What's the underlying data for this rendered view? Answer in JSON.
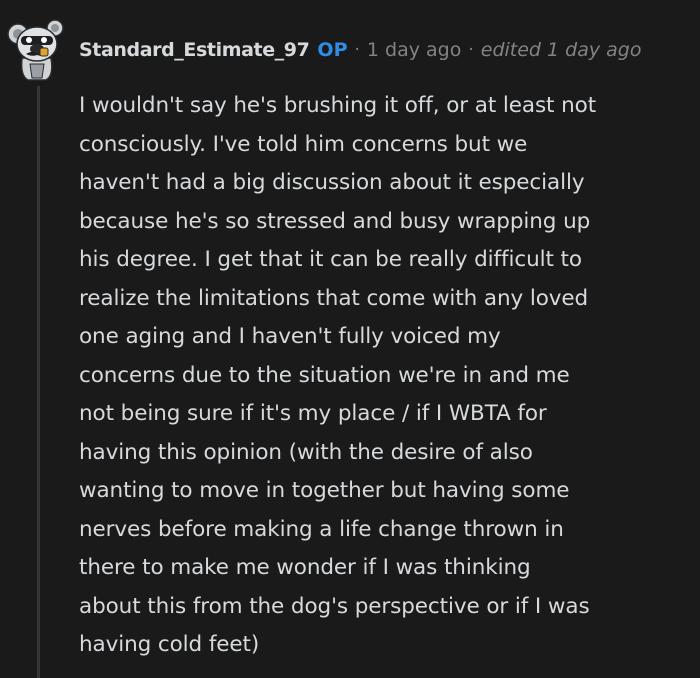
{
  "comment": {
    "author": "Standard_Estimate_97",
    "op_badge": "OP",
    "separator": "·",
    "time": "1 day ago",
    "edited": "edited 1 day ago",
    "avatar_icon": "snoo-avatar-icon",
    "body_lines": [
      "I wouldn't say he's brushing it off, or at least not",
      "consciously. I've told him concerns but we",
      "haven't had a big discussion about it especially",
      "because he's so stressed and busy wrapping up",
      "his degree. I get that it can be really difficult to",
      "realize the limitations that come with any loved",
      "one aging and I haven't fully voiced my",
      "concerns due to the situation we're in and me",
      "not being sure if it's my place / if I WBTA for",
      "having this opinion (with the desire of also",
      "wanting to move in together but having some",
      "nerves before making a life change thrown in",
      "there to make me wonder if I was thinking",
      "about this from the dog's perspective or if I was",
      "having cold feet)"
    ]
  },
  "colors": {
    "background": "#1a1a1b",
    "text": "#d7dadc",
    "muted": "#818384",
    "op": "#2e8de6",
    "thread_line": "#343536"
  }
}
